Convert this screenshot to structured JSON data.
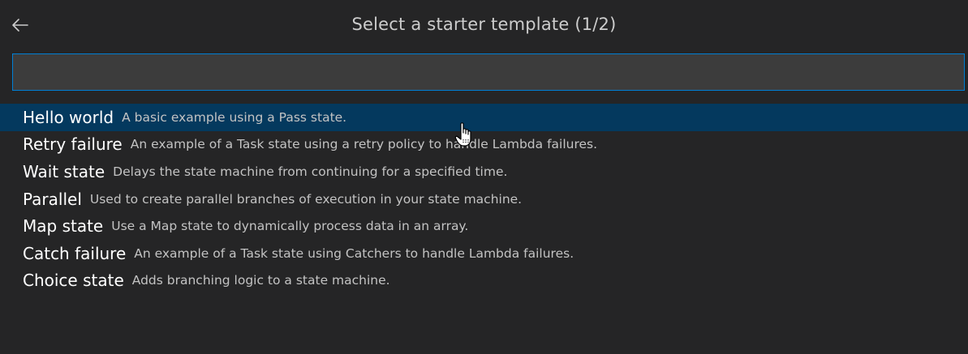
{
  "header": {
    "title": "Select a starter template (1/2)",
    "back_icon": "arrow-left-icon"
  },
  "search": {
    "value": "",
    "placeholder": ""
  },
  "templates": [
    {
      "label": "Hello world",
      "description": "A basic example using a Pass state."
    },
    {
      "label": "Retry failure",
      "description": "An example of a Task state using a retry policy to handle Lambda failures."
    },
    {
      "label": "Wait state",
      "description": "Delays the state machine from continuing for a specified time."
    },
    {
      "label": "Parallel",
      "description": "Used to create parallel branches of execution in your state machine."
    },
    {
      "label": "Map state",
      "description": "Use a Map state to dynamically process data in an array."
    },
    {
      "label": "Catch failure",
      "description": "An example of a Task state using Catchers to handle Lambda failures."
    },
    {
      "label": "Choice state",
      "description": "Adds branching logic to a state machine."
    }
  ],
  "colors": {
    "background": "#252526",
    "selection": "#04395e",
    "focus_border": "#007fd4",
    "input_background": "#3c3c3c"
  }
}
